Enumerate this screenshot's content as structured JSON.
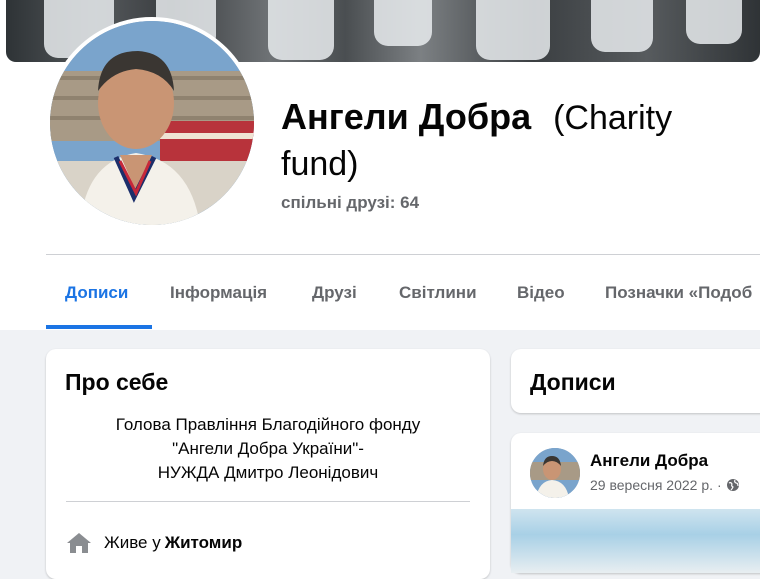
{
  "profile": {
    "name": "Ангели Добра",
    "name_suffix": "(Charity fund)",
    "mutual_friends": "спільні друзі: 64"
  },
  "tabs": [
    {
      "label": "Дописи",
      "active": true
    },
    {
      "label": "Інформація",
      "active": false
    },
    {
      "label": "Друзі",
      "active": false
    },
    {
      "label": "Світлини",
      "active": false
    },
    {
      "label": "Відео",
      "active": false
    },
    {
      "label": "Позначки «Подоб",
      "active": false
    }
  ],
  "about": {
    "title": "Про себе",
    "bio_lines": [
      "Голова Правління Благодійного фонду",
      "\"Ангели Добра України\"-",
      "НУЖДА Дмитро Леонідович"
    ],
    "lives_prefix": "Живе у",
    "lives_city": "Житомир"
  },
  "posts": {
    "title": "Дописи",
    "items": [
      {
        "author": "Ангели Добра",
        "date": "29 вересня 2022 р.",
        "privacy_icon": "globe-icon"
      }
    ]
  },
  "colors": {
    "accent": "#1b74e4",
    "secondary_text": "#65676b",
    "page_bg": "#f0f2f5"
  }
}
